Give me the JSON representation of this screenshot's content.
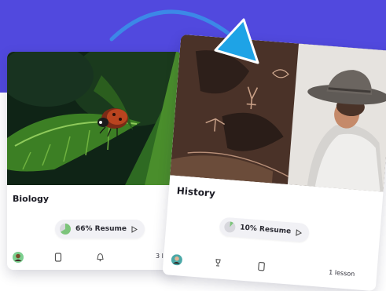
{
  "colors": {
    "hero_band": "#5149de",
    "arc_stroke": "#3a8fe8",
    "cursor": "#1ea3e6",
    "progress_fill": "#7cc47a",
    "pill_bg": "#f1f1f5"
  },
  "cards": [
    {
      "title": "Biology",
      "progress_percent": 66,
      "resume_label": "66% Resume",
      "lesson_count_partial": "3 l",
      "icons": [
        "avatar-icon",
        "document-icon",
        "bell-icon"
      ]
    },
    {
      "title": "History",
      "progress_percent": 10,
      "resume_label": "10% Resume",
      "lesson_count": "1 lesson",
      "icons": [
        "avatar-icon",
        "trophy-icon",
        "document-icon"
      ]
    }
  ],
  "cursor_icon": "pointer-arrow-icon"
}
